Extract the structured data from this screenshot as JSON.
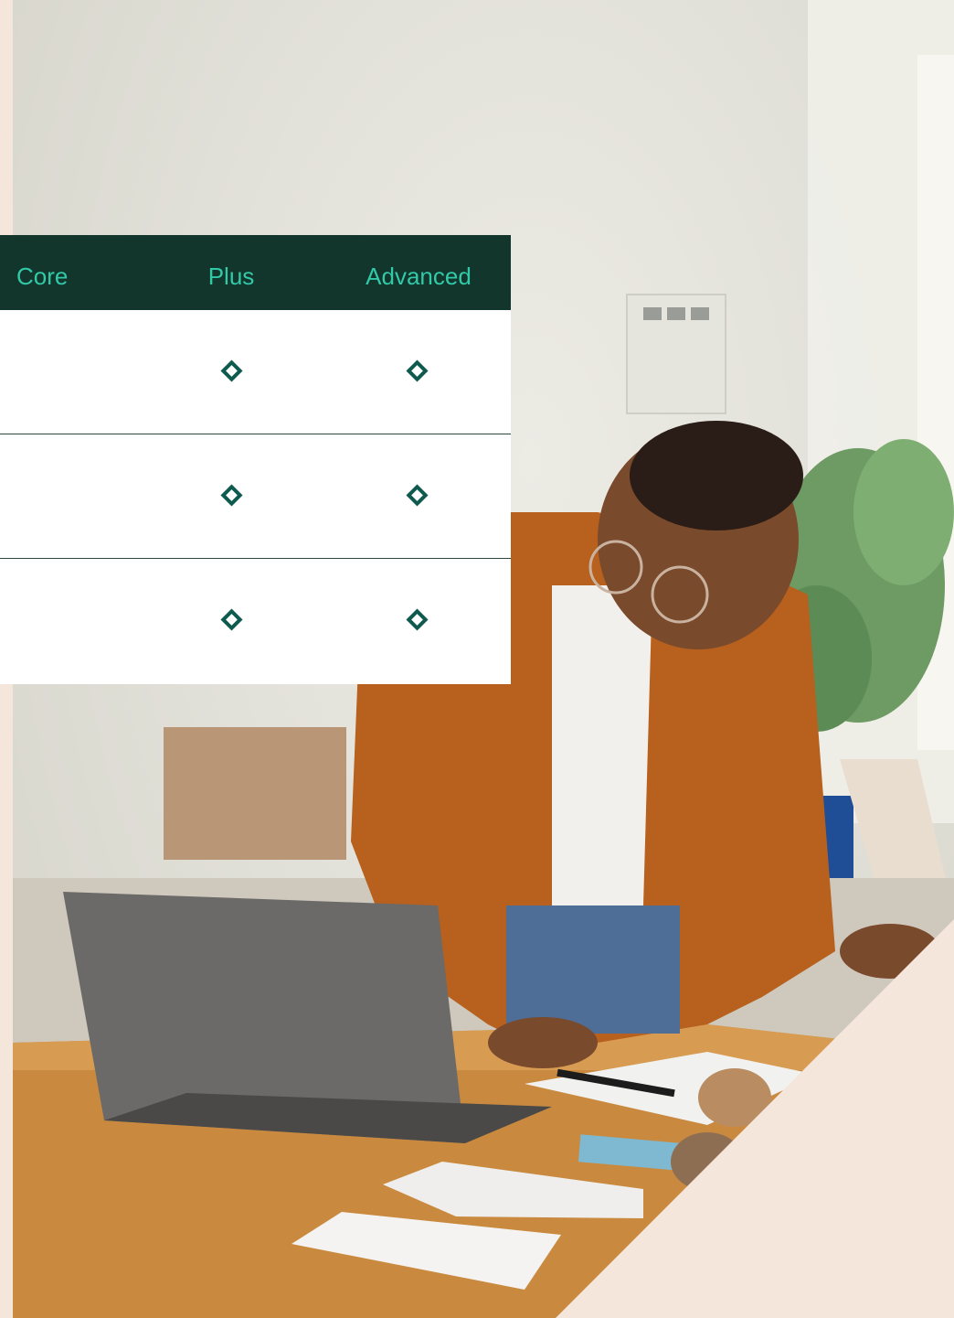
{
  "comparison_table": {
    "columns": [
      "Core",
      "Plus",
      "Advanced"
    ],
    "rows": [
      {
        "core": false,
        "plus": true,
        "advanced": true
      },
      {
        "core": false,
        "plus": true,
        "advanced": true
      },
      {
        "core": false,
        "plus": true,
        "advanced": true
      }
    ]
  },
  "colors": {
    "header_bg": "#12352C",
    "header_text": "#32C9A8",
    "check_mark": "#0E5A4E",
    "accent_background": "#F5E6DC"
  },
  "icons": {
    "check": "diamond-icon"
  },
  "photo": {
    "subject": "man-at-desk-with-laptop"
  }
}
